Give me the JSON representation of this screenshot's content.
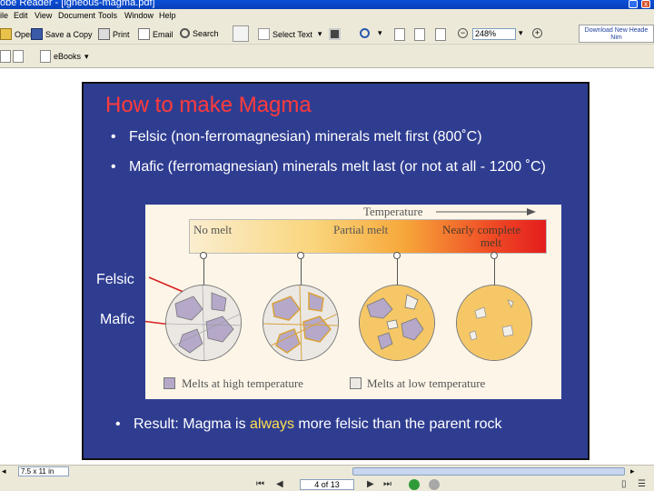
{
  "window": {
    "title": "obe Reader - [igneous-magma.pdf]",
    "min_glyph": "_",
    "close_glyph": "x"
  },
  "menu": [
    "ile",
    "Edit",
    "View",
    "Document",
    "Tools",
    "Window",
    "Help"
  ],
  "toolbar": {
    "open": "Open",
    "save_copy": "Save a Copy",
    "print": "Print",
    "email": "Email",
    "search": "Search",
    "select_text": "Select Text",
    "zoom_value": "248%",
    "promo": [
      "Download New Heade",
      "Nim"
    ],
    "ebooks": "eBooks"
  },
  "slide": {
    "title": "How to make Magma",
    "bullet1": "Felsic (non-ferromagnesian) minerals melt first (800˚C)",
    "bullet2": "Mafic (ferromagnesian) minerals melt last (or not at all - 1200 ˚C)",
    "bullet3_pre": "Result: Magma is ",
    "bullet3_hl": "always",
    "bullet3_post": " more felsic than the parent rock",
    "bullet_mark": "•",
    "label_felsic": "Felsic",
    "label_mafic": "Mafic",
    "figure": {
      "temperature": "Temperature",
      "no_melt": "No melt",
      "partial_melt": "Partial melt",
      "nearly_complete_1": "Nearly complete",
      "nearly_complete_2": "melt",
      "legend_high": "Melts at high temperature",
      "legend_low": "Melts at low temperature"
    }
  },
  "status": {
    "page_size": "7.5 x 11 in",
    "page_indicator": "4 of 13"
  },
  "colors": {
    "slide_bg": "#2f3d91",
    "title": "#ff3b3b",
    "highlight": "#ffe050",
    "mafic_mineral": "#b5a8c9",
    "felsic_mineral": "#ebe8e4"
  }
}
